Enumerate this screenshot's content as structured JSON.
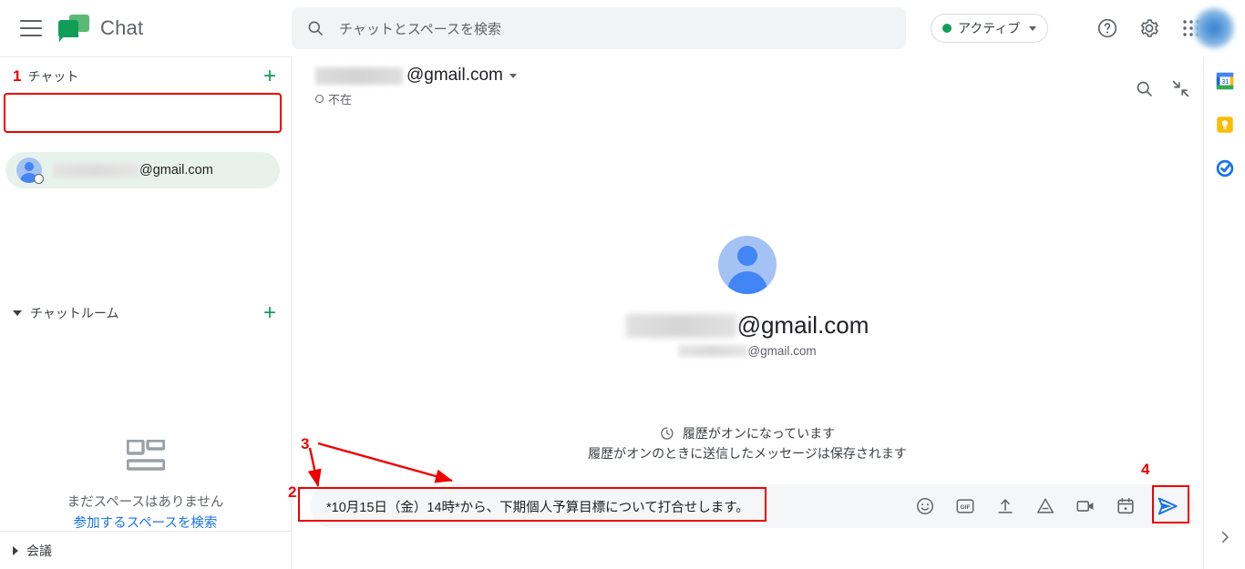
{
  "topbar": {
    "menu_icon": "hamburger-menu-icon",
    "brand_logo": "google-chat-logo",
    "brand_name": "Chat",
    "search_placeholder": "チャットとスペースを検索",
    "search_icon": "search-icon",
    "status_label": "アクティブ",
    "status_color": "#0f9d58",
    "help_icon": "help-circle-icon",
    "settings_icon": "gear-icon",
    "apps_icon": "apps-grid-icon",
    "avatar": "account-avatar"
  },
  "sidebar": {
    "chat_section": {
      "label": "チャット",
      "add_label": "+",
      "marker": "1"
    },
    "chat_items": [
      {
        "name_suffix": "@gmail.com",
        "avatar": "contact-avatar",
        "selected": true
      }
    ],
    "rooms_section": {
      "label": "チャットルーム",
      "add_label": "+"
    },
    "empty_spaces": {
      "icon": "spaces-grid-icon",
      "message": "まだスペースはありません",
      "link": "参加するスペースを検索"
    },
    "meetings_section": {
      "label": "会議"
    }
  },
  "conversation": {
    "title_suffix": "@gmail.com",
    "title_caret": "chevron-down-icon",
    "status": "不在",
    "search_icon": "search-icon",
    "collapse_icon": "collapse-icon"
  },
  "main": {
    "avatar": "contact-avatar-large",
    "display_name_suffix": "@gmail.com",
    "secondary_email_suffix": "@gmail.com",
    "history_icon": "history-clock-icon",
    "history_title": "履歴がオンになっています",
    "history_description": "履歴がオンのときに送信したメッセージは保存されます"
  },
  "composer": {
    "message": "*10月15日（金）14時*から、下期個人予算目標について打合せします。",
    "icons": [
      "emoji-icon",
      "gif-icon",
      "upload-icon",
      "google-drive-icon",
      "video-camera-icon",
      "calendar-icon"
    ],
    "send_icon": "send-icon",
    "send_color": "#1a73e8"
  },
  "rail": {
    "icons": [
      "google-calendar-icon",
      "google-keep-icon",
      "google-tasks-icon"
    ],
    "expand_icon": "chevron-right-icon"
  },
  "annotations": {
    "markers": [
      "1",
      "2",
      "3",
      "4"
    ],
    "color": "#ee0000"
  }
}
